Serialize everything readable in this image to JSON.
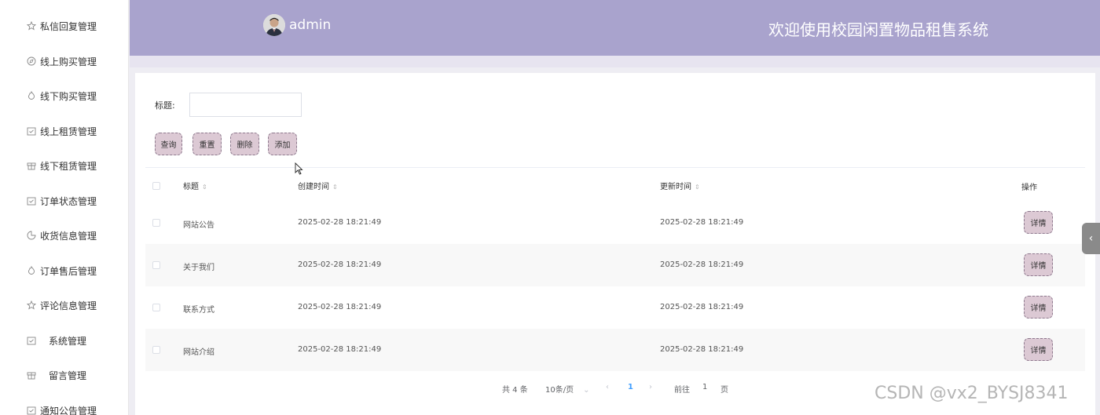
{
  "sidebar": {
    "items": [
      {
        "label": "私信回复管理",
        "icon": "star-icon"
      },
      {
        "label": "线上购买管理",
        "icon": "compass-icon"
      },
      {
        "label": "线下购买管理",
        "icon": "flame-icon"
      },
      {
        "label": "线上租赁管理",
        "icon": "calendar-check-icon"
      },
      {
        "label": "线下租赁管理",
        "icon": "gift-icon"
      },
      {
        "label": "订单状态管理",
        "icon": "calendar-check-icon"
      },
      {
        "label": "收货信息管理",
        "icon": "chart-icon"
      },
      {
        "label": "订单售后管理",
        "icon": "flame-icon"
      },
      {
        "label": "评论信息管理",
        "icon": "star-icon"
      },
      {
        "label": "系统管理",
        "icon": "calendar-check-icon"
      },
      {
        "label": "留言管理",
        "icon": "gift-icon"
      },
      {
        "label": "通知公告管理",
        "icon": "calendar-check-icon"
      }
    ]
  },
  "header": {
    "user": "admin",
    "title": "欢迎使用校园闲置物品租售系统"
  },
  "search": {
    "label": "标题:",
    "value": ""
  },
  "toolbar": {
    "query": "查询",
    "reset": "重置",
    "delete": "删除",
    "add": "添加"
  },
  "table": {
    "headers": {
      "title": "标题",
      "created": "创建时间",
      "updated": "更新时间",
      "actions": "操作"
    },
    "rows": [
      {
        "title": "网站公告",
        "created": "2025-02-28 18:21:49",
        "updated": "2025-02-28 18:21:49",
        "action": "详情"
      },
      {
        "title": "关于我们",
        "created": "2025-02-28 18:21:49",
        "updated": "2025-02-28 18:21:49",
        "action": "详情"
      },
      {
        "title": "联系方式",
        "created": "2025-02-28 18:21:49",
        "updated": "2025-02-28 18:21:49",
        "action": "详情"
      },
      {
        "title": "网站介绍",
        "created": "2025-02-28 18:21:49",
        "updated": "2025-02-28 18:21:49",
        "action": "详情"
      }
    ]
  },
  "pagination": {
    "total": "共 4 条",
    "page_size": "10条/页",
    "current": "1",
    "goto_prefix": "前往",
    "goto_value": "1",
    "goto_suffix": "页"
  },
  "watermark": "CSDN @vx2_BYSJ8341",
  "colors": {
    "header": "#a9a3cd",
    "button": "#dcc9d4",
    "accent": "#409eff"
  }
}
